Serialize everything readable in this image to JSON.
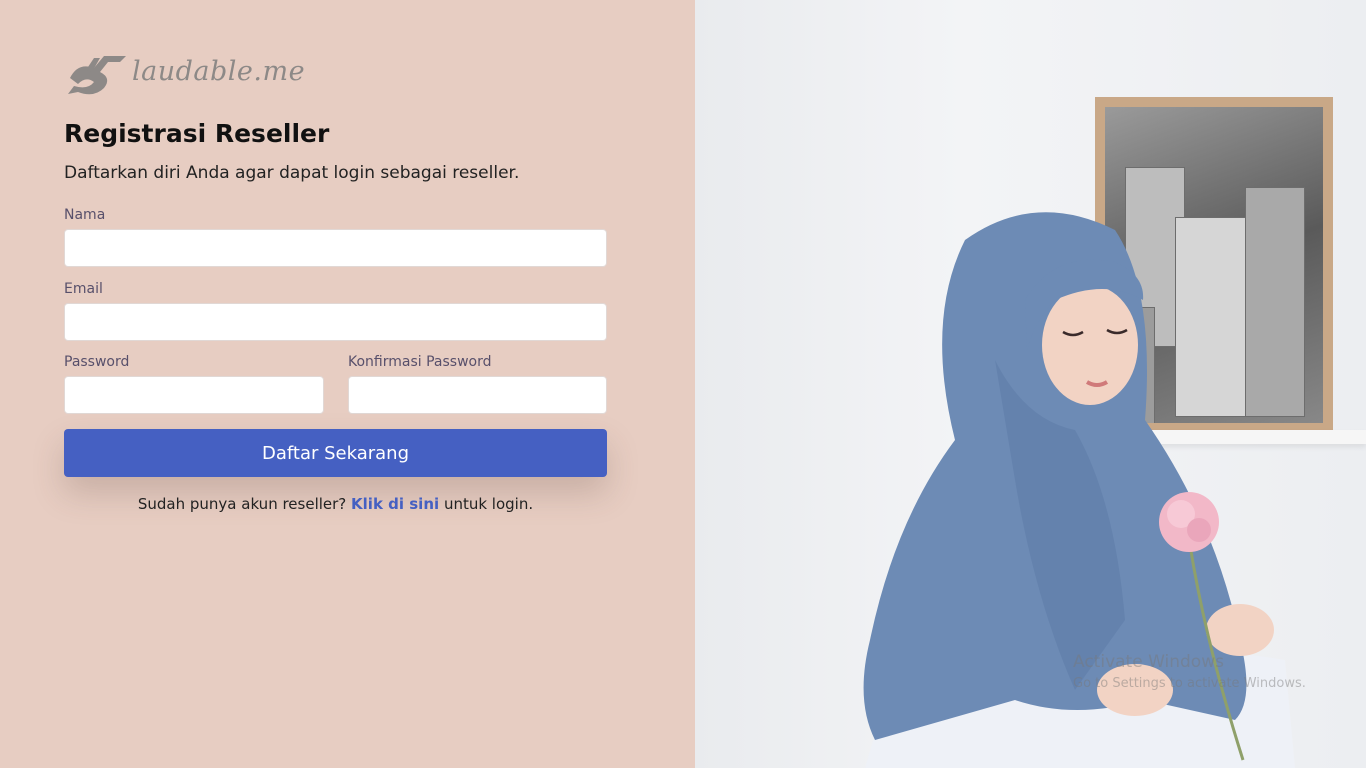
{
  "brand": {
    "name": "laudable.me"
  },
  "form": {
    "title": "Registrasi Reseller",
    "subtitle": "Daftarkan diri Anda agar dapat login sebagai reseller.",
    "fields": {
      "nama_label": "Nama",
      "nama_value": "",
      "email_label": "Email",
      "email_value": "",
      "password_label": "Password",
      "password_value": "",
      "confirm_label": "Konfirmasi Password",
      "confirm_value": ""
    },
    "submit_label": "Daftar Sekarang",
    "footer": {
      "prefix": "Sudah punya akun reseller?",
      "link_label": "Klik di sini",
      "suffix": "untuk login."
    }
  },
  "watermark": {
    "line1": "Activate Windows",
    "line2": "Go to Settings to activate Windows."
  },
  "colors": {
    "left_background": "#e7cdc2",
    "button": "#4560c2",
    "link": "#4560c2",
    "hijab": "#6d8bb5"
  },
  "icons": {
    "logo": "laudable-logo-icon"
  }
}
